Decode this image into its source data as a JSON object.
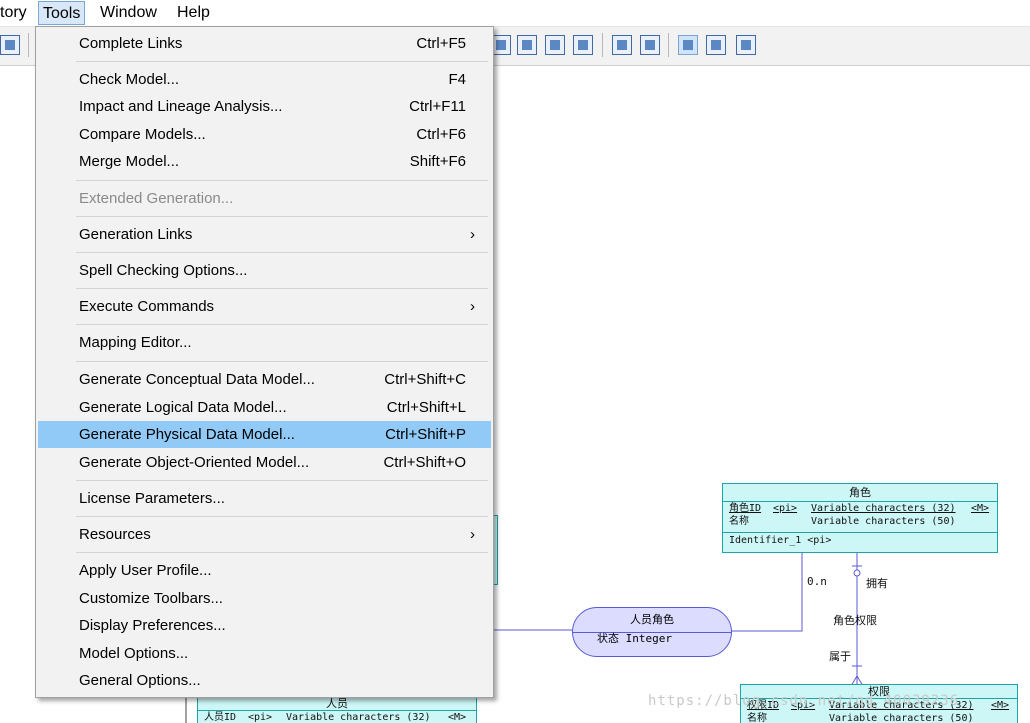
{
  "menubar": {
    "items": [
      "tory",
      "Tools",
      "Window",
      "Help"
    ]
  },
  "tools_menu": {
    "items": [
      {
        "label": "Complete Links",
        "shortcut": "Ctrl+F5"
      },
      {
        "label": "Check Model...",
        "shortcut": "F4"
      },
      {
        "label": "Impact and Lineage Analysis...",
        "shortcut": "Ctrl+F11"
      },
      {
        "label": "Compare Models...",
        "shortcut": "Ctrl+F6"
      },
      {
        "label": "Merge Model...",
        "shortcut": "Shift+F6"
      },
      {
        "label": "Extended Generation...",
        "shortcut": ""
      },
      {
        "label": "Generation Links",
        "shortcut": ""
      },
      {
        "label": "Spell Checking Options...",
        "shortcut": ""
      },
      {
        "label": "Execute Commands",
        "shortcut": ""
      },
      {
        "label": "Mapping Editor...",
        "shortcut": ""
      },
      {
        "label": "Generate Conceptual Data Model...",
        "shortcut": "Ctrl+Shift+C"
      },
      {
        "label": "Generate Logical Data Model...",
        "shortcut": "Ctrl+Shift+L"
      },
      {
        "label": "Generate Physical Data Model...",
        "shortcut": "Ctrl+Shift+P"
      },
      {
        "label": "Generate Object-Oriented Model...",
        "shortcut": "Ctrl+Shift+O"
      },
      {
        "label": "License Parameters...",
        "shortcut": ""
      },
      {
        "label": "Resources",
        "shortcut": ""
      },
      {
        "label": "Apply User Profile...",
        "shortcut": ""
      },
      {
        "label": "Customize Toolbars...",
        "shortcut": ""
      },
      {
        "label": "Display Preferences...",
        "shortcut": ""
      },
      {
        "label": "Model Options...",
        "shortcut": ""
      },
      {
        "label": "General Options...",
        "shortcut": ""
      }
    ],
    "submenu_arrow": "›"
  },
  "diagram": {
    "entity_role": {
      "title": "角色",
      "rows": [
        {
          "name": "角色ID",
          "tag": "<pi>",
          "type": "Variable characters (32)",
          "flag": "<M>"
        },
        {
          "name": "名称",
          "tag": "",
          "type": "Variable characters (50)",
          "flag": ""
        }
      ],
      "identifier": "Identifier_1  <pi>"
    },
    "entity_permission": {
      "title": "权限",
      "rows": [
        {
          "name": "权限ID",
          "tag": "<pi>",
          "type": "Variable characters (32)",
          "flag": "<M>"
        },
        {
          "name": "名称",
          "tag": "",
          "type": "Variable characters (50)",
          "flag": ""
        }
      ]
    },
    "entity_person": {
      "title": "人员",
      "rows": [
        {
          "name": "人员ID",
          "tag": "<pi>",
          "type": "Variable characters (32)",
          "flag": "<M>"
        }
      ]
    },
    "association": {
      "title": "人员角色",
      "attribute": "状态  Integer"
    },
    "labels": {
      "cardinality": "0.n",
      "owns": "拥有",
      "role_permission": "角色权限",
      "belongs": "属于"
    },
    "watermark": "https://blog.csdn.net/qq_40039236"
  },
  "colors": {
    "highlight": "#91c9f7",
    "entity_fill": "#cdf6f6",
    "entity_border": "#1ea4a4",
    "association_fill": "#dcdcff",
    "link": "#5a5ad6"
  }
}
